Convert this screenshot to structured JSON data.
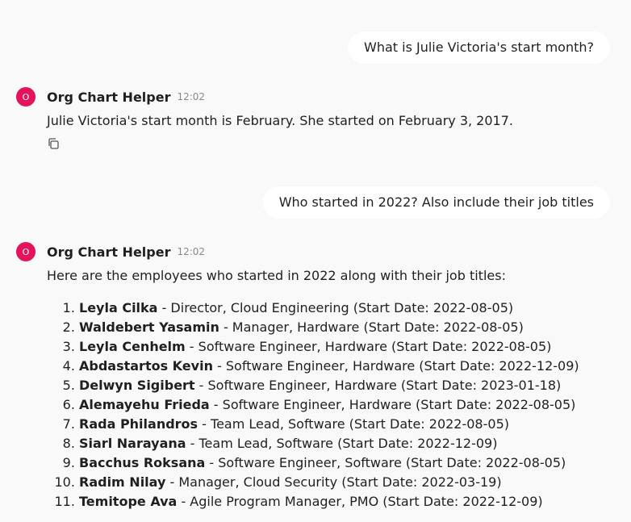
{
  "messages": [
    {
      "role": "user",
      "text": "What is Julie Victoria's start month?"
    },
    {
      "role": "assistant",
      "avatar_letter": "O",
      "name": "Org Chart Helper",
      "time": "12:02",
      "text": "Julie Victoria's start month is February. She started on February 3, 2017.",
      "copy_icon": "copy-icon"
    },
    {
      "role": "user",
      "text": "Who started in 2022? Also include their job titles"
    },
    {
      "role": "assistant",
      "avatar_letter": "O",
      "name": "Org Chart Helper",
      "time": "12:02",
      "text": "Here are the employees who started in 2022 along with their job titles:",
      "list": [
        {
          "name": "Leyla Cilka",
          "detail": " - Director, Cloud Engineering (Start Date: 2022-08-05)"
        },
        {
          "name": "Waldebert Yasamin",
          "detail": " - Manager, Hardware (Start Date: 2022-08-05)"
        },
        {
          "name": "Leyla Cenhelm",
          "detail": " - Software Engineer, Hardware (Start Date: 2022-08-05)"
        },
        {
          "name": "Abdastartos Kevin",
          "detail": " - Software Engineer, Hardware (Start Date: 2022-12-09)"
        },
        {
          "name": "Delwyn Sigibert",
          "detail": " - Software Engineer, Hardware (Start Date: 2023-01-18)"
        },
        {
          "name": "Alemayehu Frieda",
          "detail": " - Software Engineer, Hardware (Start Date: 2022-08-05)"
        },
        {
          "name": "Rada Philandros",
          "detail": " - Team Lead, Software (Start Date: 2022-08-05)"
        },
        {
          "name": "Siarl Narayana",
          "detail": " - Team Lead, Software (Start Date: 2022-12-09)"
        },
        {
          "name": "Bacchus Roksana",
          "detail": " - Software Engineer, Software (Start Date: 2022-08-05)"
        },
        {
          "name": "Radim Nilay",
          "detail": " - Manager, Cloud Security (Start Date: 2022-03-19)"
        },
        {
          "name": "Temitope Ava",
          "detail": " - Agile Program Manager, PMO (Start Date: 2022-12-09)"
        }
      ]
    }
  ],
  "colors": {
    "background": "#f9f9f9",
    "bubble": "#ffffff",
    "avatar": "#e5135c",
    "time": "#8a8a8a"
  }
}
